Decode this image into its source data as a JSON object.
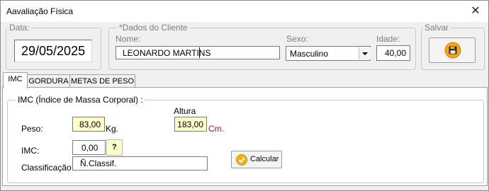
{
  "window": {
    "title": "Aavaliação Física",
    "close_glyph": "✕"
  },
  "date_group": {
    "label": "Data:",
    "value": "29/05/2025"
  },
  "client_group": {
    "label": "*Dados do Cliente",
    "name_label": "Nome:",
    "name_value": "LEONARDO MARTINS",
    "sex_label": "Sexo:",
    "sex_value": "Masculino",
    "age_label": "Idade:",
    "age_value": "40,00"
  },
  "save_group": {
    "label": "Salvar",
    "icon": "floppy-disk-icon"
  },
  "tabs": [
    {
      "label": "IMC",
      "active": true
    },
    {
      "label": "GORDURA",
      "active": false
    },
    {
      "label": "METAS DE PESO",
      "active": false
    }
  ],
  "imc_panel": {
    "group_label": "IMC (Índice de Massa Corporal) :",
    "weight_label": "Peso:",
    "weight_value": "83,00",
    "weight_unit": "Kg.",
    "height_label": "Altura",
    "height_value": "183,00",
    "height_unit": "Cm.",
    "imc_label": "IMC:",
    "imc_value": "0,00",
    "help_label": "?",
    "class_label": "Classificação:",
    "class_value": "Ñ.Classif.",
    "calc_label": "Calcular",
    "calc_icon": "check-icon"
  },
  "colors": {
    "accent_yellow": "#ffffcc",
    "unit_red": "#cc0000",
    "save_icon_orange": "#f2a61c"
  }
}
